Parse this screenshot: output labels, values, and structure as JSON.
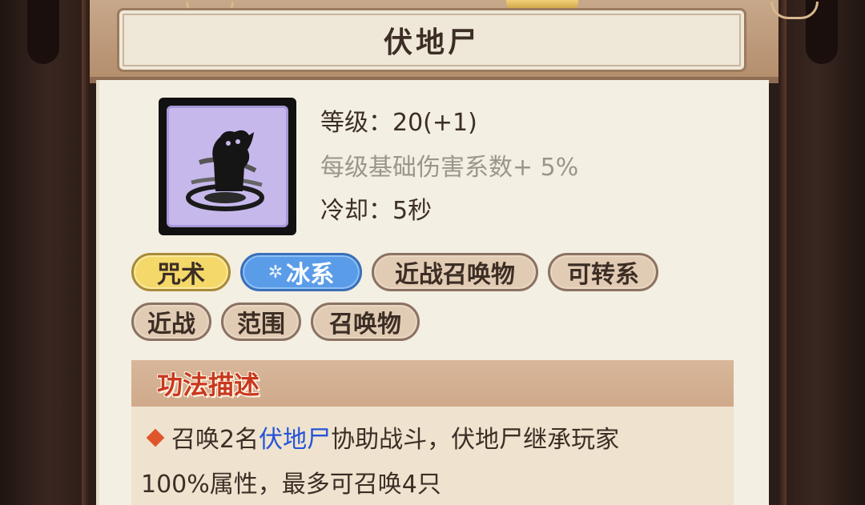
{
  "skill": {
    "name": "伏地尸",
    "level_text": "等级：20(+1)",
    "bonus_text": "每级基础伤害系数+ 5%",
    "cooldown_text": "冷却：5秒"
  },
  "tags": [
    {
      "label": "咒术"
    },
    {
      "label": "冰系"
    },
    {
      "label": "近战召唤物"
    },
    {
      "label": "可转系"
    },
    {
      "label": "近战"
    },
    {
      "label": "范围"
    },
    {
      "label": "召唤物"
    }
  ],
  "description": {
    "header": "功法描述",
    "part1": "召唤2名",
    "highlight": "伏地尸",
    "part2": "协助战斗，伏地尸继承玩家",
    "line2": "100%属性，最多可召唤4只"
  },
  "colors": {
    "highlight": "#2454d8",
    "header_text": "#c8381f",
    "yellow_tag": "#f4d86a",
    "blue_tag": "#5a9ce8"
  },
  "icons": {
    "tag_ice": "snowflake-icon",
    "skill": "zombie-skill-icon",
    "bullet": "diamond-bullet-icon"
  }
}
